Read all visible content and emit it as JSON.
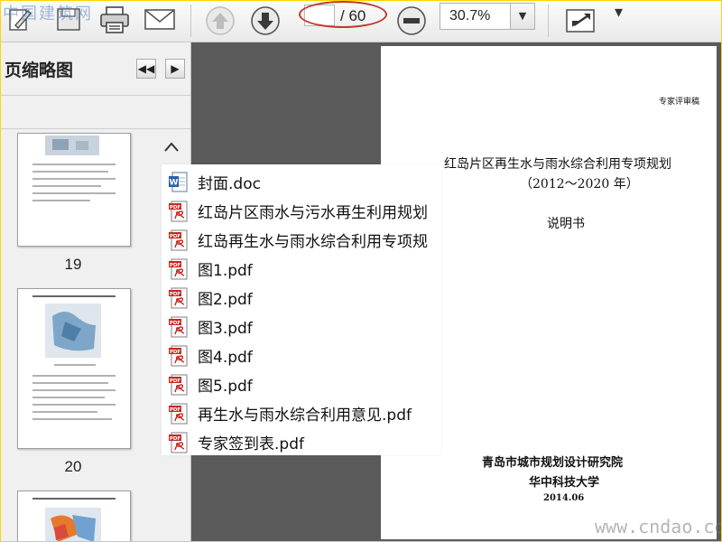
{
  "watermark": {
    "top": "中国建筑网",
    "bottom": "www.cndao.com"
  },
  "toolbar": {
    "page_current": "",
    "page_total": "/ 60",
    "zoom_value": "30.7%",
    "zoom_dropdown_arrow": "▼",
    "menu_arrow": "▾",
    "icons": [
      "edit-icon",
      "save-icon",
      "print-icon",
      "email-icon",
      "page-up-icon",
      "page-down-icon",
      "zoom-out-icon",
      "fit-page-icon",
      "menu-arrow-icon"
    ],
    "highlight_color": "#c0392b"
  },
  "sidebar": {
    "title": "页缩略图",
    "prev_label": "◀◀",
    "next_label": "▶",
    "scroll_up": "▲",
    "thumbnails": [
      {
        "page": "19"
      },
      {
        "page": "20"
      }
    ]
  },
  "file_list": {
    "items": [
      {
        "name": "封面.doc",
        "icon": "word-doc-icon"
      },
      {
        "name": "红岛片区雨水与污水再生利用规划",
        "icon": "pdf-icon"
      },
      {
        "name": "红岛再生水与雨水综合利用专项规",
        "icon": "pdf-icon"
      },
      {
        "name": "图1.pdf",
        "icon": "pdf-icon"
      },
      {
        "name": "图2.pdf",
        "icon": "pdf-icon"
      },
      {
        "name": "图3.pdf",
        "icon": "pdf-icon"
      },
      {
        "name": "图4.pdf",
        "icon": "pdf-icon"
      },
      {
        "name": "图5.pdf",
        "icon": "pdf-icon"
      },
      {
        "name": "再生水与雨水综合利用意见.pdf",
        "icon": "pdf-icon"
      },
      {
        "name": "专家签到表.pdf",
        "icon": "pdf-icon"
      }
    ]
  },
  "document": {
    "stamp": "专家评审稿",
    "title": "红岛片区再生水与雨水综合利用专项规划",
    "period": "（2012～2020 年）",
    "subtitle": "说明书",
    "org1": "青岛市城市规划设计研究院",
    "org2": "华中科技大学",
    "date": "2014.06"
  }
}
